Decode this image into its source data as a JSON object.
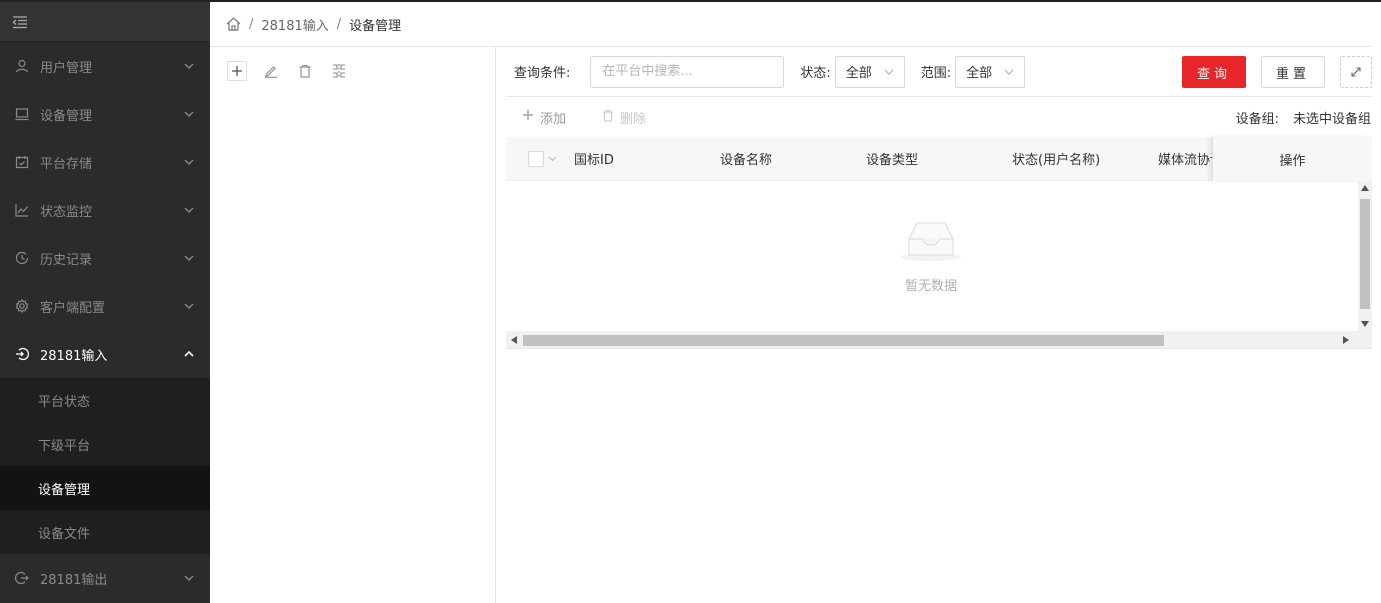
{
  "sidebar": {
    "toggle_icon": "menu-fold-icon",
    "menu": [
      {
        "label": "用户管理",
        "icon": "user-icon"
      },
      {
        "label": "设备管理",
        "icon": "monitor-icon"
      },
      {
        "label": "平台存储",
        "icon": "calendar-check-icon"
      },
      {
        "label": "状态监控",
        "icon": "line-chart-icon"
      },
      {
        "label": "历史记录",
        "icon": "history-icon"
      },
      {
        "label": "客户端配置",
        "icon": "gear-icon"
      },
      {
        "label": "28181输入",
        "icon": "login-icon"
      },
      {
        "label": "28181输出",
        "icon": "logout-icon"
      }
    ],
    "submenu": [
      {
        "label": "平台状态"
      },
      {
        "label": "下级平台"
      },
      {
        "label": "设备管理"
      },
      {
        "label": "设备文件"
      }
    ]
  },
  "breadcrumb": {
    "items": [
      "28181输入",
      "设备管理"
    ],
    "separator": "/"
  },
  "filter": {
    "query_label": "查询条件:",
    "search_placeholder": "在平台中搜索...",
    "search_value": "",
    "status_label": "状态:",
    "status_value": "全部",
    "range_label": "范围:",
    "range_value": "全部",
    "query_button": "查询",
    "reset_button": "重置"
  },
  "actions": {
    "add": "添加",
    "delete": "删除",
    "group_label": "设备组:",
    "group_value": "未选中设备组"
  },
  "table": {
    "columns": [
      "国标ID",
      "设备名称",
      "设备类型",
      "状态(用户名称)",
      "媒体流协议"
    ],
    "fixed_column": "操作",
    "empty_text": "暂无数据"
  },
  "colors": {
    "sidebar_bg": "#2b2b2b",
    "primary": "#e8262a"
  }
}
